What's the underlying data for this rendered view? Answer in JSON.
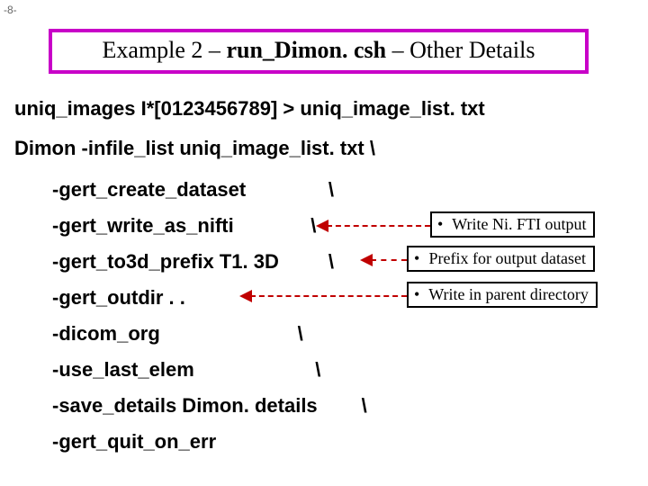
{
  "page_number": "-8-",
  "title": {
    "part1": "Example 2 – ",
    "part2_bold": "run_Dimon. csh",
    "part3": " – Other Details"
  },
  "lines": {
    "l0": "uniq_images I*[0123456789] > uniq_image_list. txt",
    "l1": "Dimon -infile_list uniq_image_list. txt  \\",
    "f1": "-gert_create_dataset               \\",
    "f2": "-gert_write_as_nifti              \\",
    "f3": "-gert_to3d_prefix T1. 3D         \\",
    "f4": "-gert_outdir . .",
    "f5": "-dicom_org                         \\",
    "f6": "-use_last_elem                      \\",
    "f7": "-save_details Dimon. details        \\",
    "f8": "-gert_quit_on_err"
  },
  "callouts": {
    "c1": "Write Ni. FTI output",
    "c2": "Prefix for output dataset",
    "c3": "Write in parent directory"
  }
}
